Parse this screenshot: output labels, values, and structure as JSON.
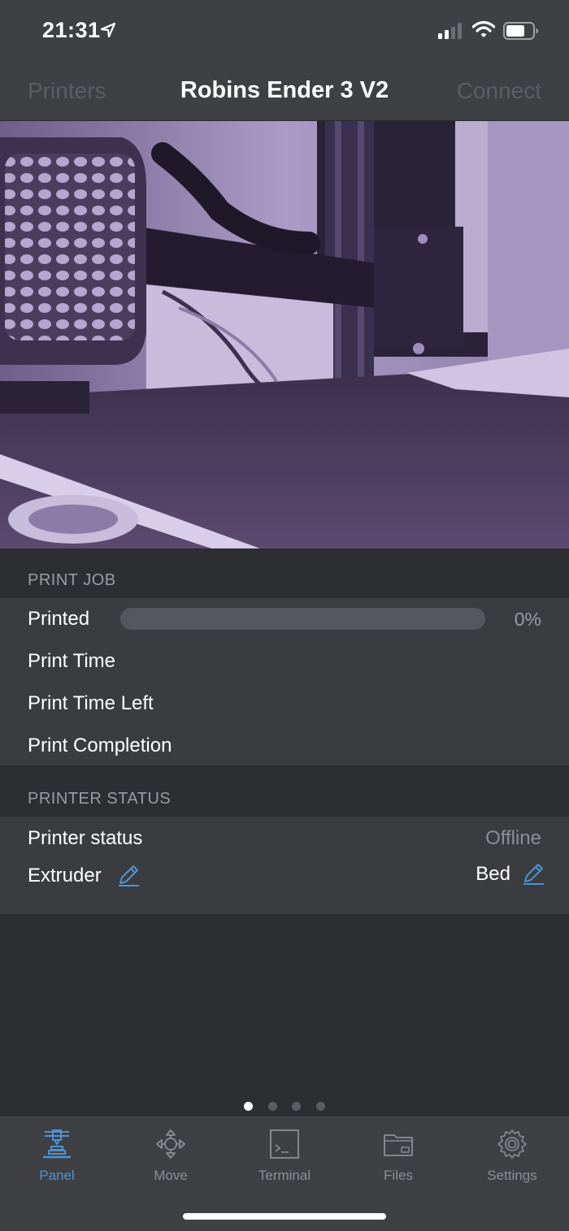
{
  "status_bar": {
    "time": "21:31"
  },
  "nav": {
    "left": "Printers",
    "title": "Robins Ender 3 V2",
    "right": "Connect"
  },
  "print_job": {
    "header": "PRINT JOB",
    "printed_label": "Printed",
    "printed_progress": 0,
    "printed_value": "0%",
    "print_time_label": "Print Time",
    "print_time_left_label": "Print Time Left",
    "print_completion_label": "Print Completion"
  },
  "printer_status": {
    "header": "PRINTER STATUS",
    "status_label": "Printer status",
    "status_value": "Offline",
    "extruder_label": "Extruder",
    "bed_label": "Bed"
  },
  "page_indicator": {
    "count": 4,
    "active": 0
  },
  "tabs": [
    {
      "label": "Panel",
      "icon": "printer-icon",
      "active": true
    },
    {
      "label": "Move",
      "icon": "move-arrows-icon",
      "active": false
    },
    {
      "label": "Terminal",
      "icon": "terminal-icon",
      "active": false
    },
    {
      "label": "Files",
      "icon": "folder-icon",
      "active": false
    },
    {
      "label": "Settings",
      "icon": "gear-icon",
      "active": false
    }
  ],
  "colors": {
    "accent": "#4e93d1",
    "background": "#2c2e32",
    "bar": "#3f4044"
  }
}
